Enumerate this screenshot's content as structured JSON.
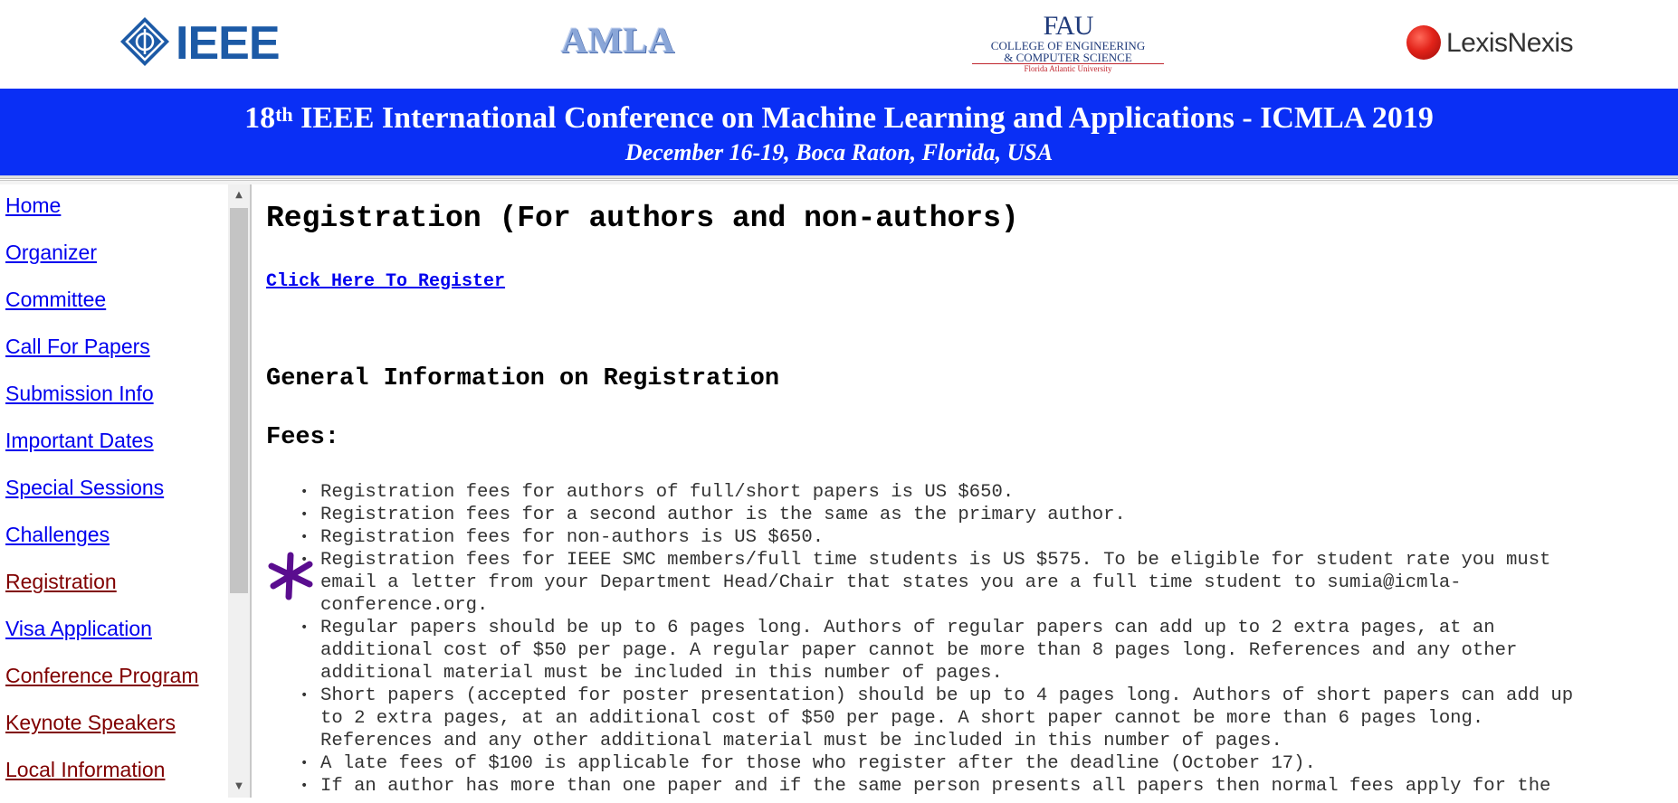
{
  "logos": {
    "ieee": "IEEE",
    "amla": "AMLA",
    "fau_mark": "FAU",
    "fau_line1": "COLLEGE OF ENGINEERING",
    "fau_line2": "& COMPUTER SCIENCE",
    "fau_line3": "Florida Atlantic University",
    "lexis": "LexisNexis"
  },
  "banner": {
    "ordinal_number": "18",
    "ordinal_suffix": "th",
    "title": " IEEE International Conference on Machine Learning and Applications - ICMLA 2019",
    "dates": "December 16-19, Boca Raton, Florida, USA",
    "background_color": "#0a2ff5"
  },
  "nav": [
    {
      "label": "Home",
      "state": "unvisited"
    },
    {
      "label": "Organizer",
      "state": "unvisited"
    },
    {
      "label": "Committee",
      "state": "unvisited"
    },
    {
      "label": "Call For Papers",
      "state": "unvisited"
    },
    {
      "label": "Submission Info",
      "state": "unvisited"
    },
    {
      "label": "Important Dates",
      "state": "unvisited"
    },
    {
      "label": "Special Sessions",
      "state": "unvisited"
    },
    {
      "label": "Challenges",
      "state": "unvisited"
    },
    {
      "label": "Registration",
      "state": "visited"
    },
    {
      "label": "Visa Application",
      "state": "unvisited"
    },
    {
      "label": "Conference Program",
      "state": "visited"
    },
    {
      "label": "Keynote Speakers",
      "state": "visited"
    },
    {
      "label": "Local Information",
      "state": "visited"
    }
  ],
  "colors": {
    "link": "#0000ee",
    "visited_link": "#800000",
    "asterisk": "#5a0d8f"
  },
  "main": {
    "title": "Registration (For authors and non-authors)",
    "register_link": "Click Here To Register",
    "general_heading": "General Information on Registration",
    "fees_heading": "Fees:",
    "fees": [
      "Registration fees for authors of full/short papers is US $650.",
      "Registration fees for a second author is the same as the primary author.",
      "Registration fees for non-authors is US $650.",
      "Registration fees for IEEE SMC members/full time students is US $575. To be eligible for student rate you must\nemail a letter from your Department Head/Chair that states you are a full time student to sumia@icmla-\nconference.org.",
      "Regular papers should be up to 6 pages long. Authors of regular papers can add up to 2 extra pages, at an\nadditional cost of $50 per page. A regular paper cannot be more than 8 pages long. References and any other\nadditional material must be included in this number of pages.",
      "Short papers (accepted for poster presentation) should be up to 4 pages long. Authors of short papers can add up\nto 2 extra pages, at an additional cost of $50 per page. A short paper cannot be more than 6 pages long.\nReferences and any other additional material must be included in this number of pages.",
      "A late fees of $100 is applicable for those who register after the deadline (October 17).",
      "If an author has more than one paper and if the same person presents all papers then normal fees apply for the"
    ]
  }
}
